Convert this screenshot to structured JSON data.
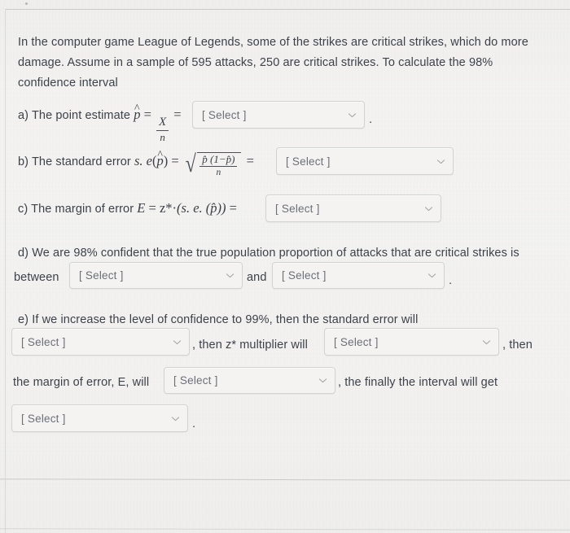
{
  "document": {
    "intro": "In the computer game League of Legends, some of the strikes are critical strikes, which do more damage. Assume in a sample of 595 attacks, 250 are critical strikes. To calculate the 98% confidence interval",
    "select_placeholder": "[ Select ]",
    "caret_icon": "chevron-down-icon"
  },
  "part_a": {
    "prefix": "a) The point estimate",
    "math": {
      "p_hat": "p",
      "hat": "^",
      "equals": "=",
      "numerator": "X",
      "denominator": "n",
      "equals2": "="
    },
    "select_value": "[ Select ]",
    "suffix": "."
  },
  "part_b": {
    "prefix": "b) The standard error",
    "math": {
      "s_e": "s. e",
      "open": "(",
      "p_hat": "p",
      "hat": "^",
      "close": ")",
      "equals": "=",
      "radical": "√",
      "numerator": "p̂ (1−p̂)",
      "denominator": "n",
      "equals2": "="
    },
    "select_value": "[ Select ]"
  },
  "part_c": {
    "prefix": "c) The margin of error",
    "math": {
      "E": "E",
      "equals": "=",
      "z_star": "z*",
      "dot": "·",
      "expr": "(s. e. (p̂))",
      "equals2": "="
    },
    "select_value": "[ Select ]"
  },
  "part_d": {
    "line1": "d) We are 98% confident that the true population proportion of attacks that are critical strikes is",
    "between_label": "between",
    "select_lower": "[ Select ]",
    "and_label": "and",
    "select_upper": "[ Select ]",
    "suffix": "."
  },
  "part_e": {
    "line1": "e) If we increase the level of confidence to 99%, then the standard error will",
    "select_standard_error": "[ Select ]",
    "text_then_z": ", then z* multiplier will",
    "select_z_multiplier": "[ Select ]",
    "text_then": ", then",
    "text_margin_prefix": "the margin of error, E, will",
    "select_margin_error": "[ Select ]",
    "text_finally": ", the finally the interval will get",
    "select_interval": "[ Select ]",
    "suffix": "."
  },
  "colors": {
    "background": "#f2f1ef",
    "text": "#3c424a",
    "placeholder": "#6a6f77",
    "border": "#d2d2d0",
    "rule": "#c9c9c7"
  }
}
